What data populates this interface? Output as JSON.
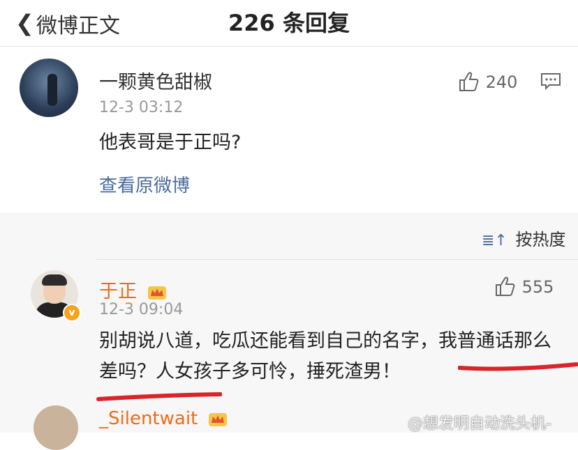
{
  "header": {
    "back_label": "微博正文",
    "title": "226 条回复"
  },
  "post": {
    "username": "一颗黄色甜椒",
    "timestamp": "12-3 03:12",
    "text": "他表哥是于正吗?",
    "like_count": "240",
    "view_original_link": "查看原微博"
  },
  "sort": {
    "label": "按热度"
  },
  "replies": [
    {
      "username": "于正",
      "timestamp": "12-3 09:04",
      "like_count": "555",
      "text": "别胡说八道，吃瓜还能看到自己的名字，我普通话那么差吗？人女孩子多可怜，捶死渣男！"
    },
    {
      "username": "_Silentwait"
    }
  ],
  "watermark": "@想发明自动洗头机-",
  "colors": {
    "username_accent": "#f16a14",
    "link": "#4a6b9c",
    "annotation_red": "#d9252a"
  }
}
